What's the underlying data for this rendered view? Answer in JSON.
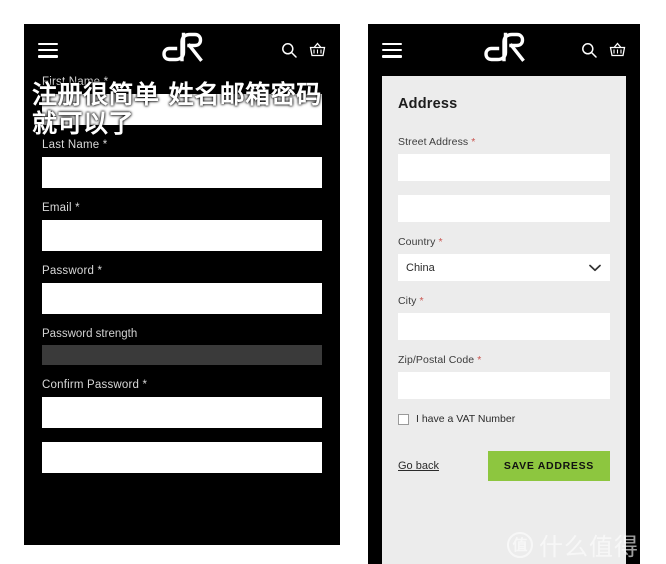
{
  "appbar": {
    "menu_icon": "hamburger-menu-icon",
    "logo_icon": "rr-brand-logo",
    "search_icon": "search-icon",
    "basket_icon": "shopping-basket-icon"
  },
  "left_panel": {
    "annotation": "注册很简单 姓名邮箱密码就可以了",
    "fields": [
      {
        "label": "First Name *",
        "value": "",
        "placeholder": ""
      },
      {
        "label": "Last Name *",
        "value": "",
        "placeholder": ""
      },
      {
        "label": "Email *",
        "value": "",
        "placeholder": ""
      },
      {
        "label": "Password *",
        "value": "",
        "placeholder": ""
      }
    ],
    "strength_label": "Password strength",
    "confirm": {
      "label": "Confirm Password *",
      "value": "",
      "placeholder": ""
    }
  },
  "right_panel": {
    "heading": "Address",
    "street": {
      "label": "Street Address ",
      "required": "*",
      "value": "",
      "value2": ""
    },
    "country": {
      "label": "Country ",
      "required": "*",
      "selected": "China"
    },
    "city": {
      "label": "City ",
      "required": "*",
      "value": ""
    },
    "zip": {
      "label": "Zip/Postal Code ",
      "required": "*",
      "value": ""
    },
    "vat": {
      "label": "I have a VAT Number",
      "checked": false
    },
    "go_back": "Go back",
    "save_button": "SAVE ADDRESS",
    "accent_color": "#8dc63f"
  },
  "watermark": {
    "badge": "值",
    "text": "什么值得买"
  }
}
